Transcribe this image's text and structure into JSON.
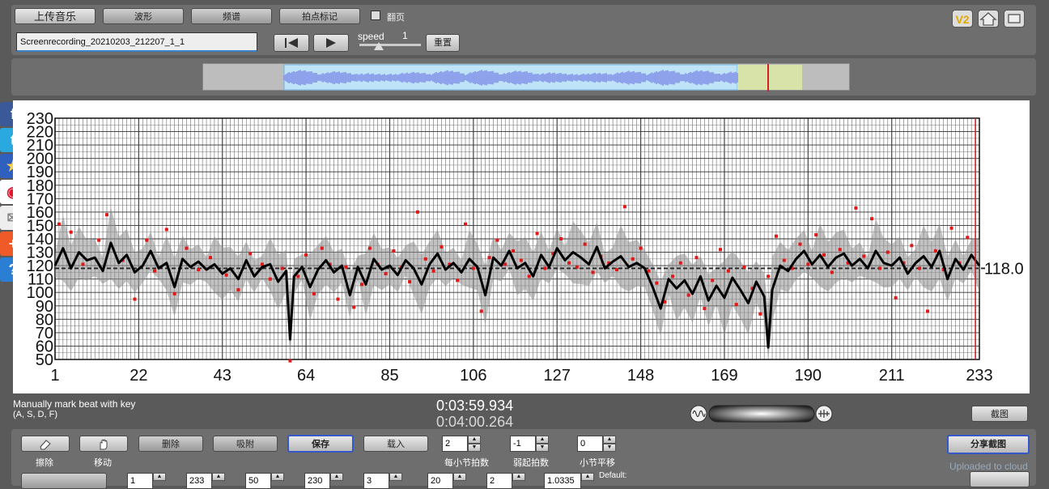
{
  "toolbar": {
    "upload_label": "上传音乐",
    "waveform_label": "波形",
    "spectrum_label": "频谱",
    "beat_mark_label": "拍点标记",
    "flip_label": "翻页",
    "filename": "Screenrecording_20210203_212207_1_1",
    "speed_label": "speed",
    "speed_value": "1",
    "reset_label": "重置",
    "v2_badge": "V2"
  },
  "chart_data": {
    "type": "line",
    "xlim": [
      1,
      233
    ],
    "ylim": [
      50,
      230
    ],
    "x_ticks": [
      1,
      22,
      43,
      64,
      85,
      106,
      127,
      148,
      169,
      190,
      211,
      233
    ],
    "y_ticks": [
      50,
      60,
      70,
      80,
      90,
      100,
      110,
      120,
      130,
      140,
      150,
      160,
      170,
      180,
      190,
      200,
      210,
      220,
      230
    ],
    "reference_value": 118.0,
    "reference_label": "118.0",
    "series": [
      {
        "x": [
          1,
          3,
          5,
          7,
          9,
          11,
          13,
          15,
          17,
          19,
          21,
          23,
          25,
          27,
          29,
          31,
          33,
          35,
          37,
          39,
          41,
          43,
          45,
          47,
          49,
          51,
          53,
          55,
          57,
          59,
          60,
          61,
          63,
          65,
          67,
          69,
          71,
          73,
          75,
          77,
          79,
          81,
          83,
          85,
          87,
          89,
          91,
          93,
          95,
          97,
          99,
          101,
          103,
          105,
          107,
          109,
          111,
          113,
          115,
          117,
          119,
          121,
          123,
          125,
          127,
          129,
          131,
          133,
          135,
          137,
          139,
          141,
          143,
          145,
          147,
          149,
          151,
          153,
          155,
          157,
          159,
          161,
          163,
          165,
          167,
          169,
          171,
          173,
          175,
          177,
          179,
          180,
          181,
          183,
          185,
          187,
          189,
          191,
          193,
          195,
          197,
          199,
          201,
          203,
          205,
          207,
          209,
          211,
          213,
          215,
          217,
          219,
          221,
          223,
          225,
          227,
          229,
          231,
          233
        ],
        "values": [
          120,
          133,
          118,
          130,
          124,
          126,
          116,
          137,
          122,
          128,
          115,
          120,
          131,
          118,
          122,
          104,
          125,
          119,
          123,
          117,
          121,
          114,
          118,
          110,
          124,
          112,
          119,
          121,
          108,
          116,
          65,
          112,
          119,
          104,
          117,
          124,
          115,
          120,
          98,
          119,
          106,
          125,
          117,
          120,
          113,
          124,
          118,
          106,
          121,
          129,
          117,
          122,
          115,
          125,
          119,
          98,
          126,
          120,
          131,
          118,
          122,
          112,
          128,
          119,
          133,
          124,
          130,
          126,
          121,
          134,
          118,
          123,
          127,
          119,
          122,
          118,
          104,
          88,
          110,
          103,
          109,
          99,
          112,
          94,
          105,
          96,
          111,
          102,
          92,
          108,
          97,
          59,
          102,
          120,
          116,
          125,
          131,
          121,
          128,
          119,
          126,
          129,
          120,
          125,
          118,
          131,
          122,
          120,
          126,
          114,
          122,
          127,
          119,
          131,
          110,
          125,
          117,
          128,
          120
        ]
      }
    ],
    "scatter_points": [
      [
        2,
        151
      ],
      [
        5,
        145
      ],
      [
        8,
        121
      ],
      [
        12,
        139
      ],
      [
        14,
        158
      ],
      [
        18,
        124
      ],
      [
        21,
        95
      ],
      [
        24,
        139
      ],
      [
        26,
        116
      ],
      [
        29,
        147
      ],
      [
        31,
        99
      ],
      [
        34,
        133
      ],
      [
        37,
        117
      ],
      [
        40,
        126
      ],
      [
        44,
        113
      ],
      [
        47,
        102
      ],
      [
        50,
        129
      ],
      [
        53,
        121
      ],
      [
        55,
        110
      ],
      [
        58,
        118
      ],
      [
        60,
        49
      ],
      [
        62,
        112
      ],
      [
        64,
        128
      ],
      [
        66,
        99
      ],
      [
        68,
        133
      ],
      [
        70,
        121
      ],
      [
        72,
        95
      ],
      [
        74,
        119
      ],
      [
        76,
        89
      ],
      [
        78,
        106
      ],
      [
        80,
        133
      ],
      [
        82,
        121
      ],
      [
        84,
        114
      ],
      [
        86,
        131
      ],
      [
        88,
        119
      ],
      [
        90,
        108
      ],
      [
        92,
        160
      ],
      [
        94,
        125
      ],
      [
        96,
        116
      ],
      [
        98,
        134
      ],
      [
        100,
        121
      ],
      [
        102,
        109
      ],
      [
        104,
        151
      ],
      [
        106,
        118
      ],
      [
        108,
        86
      ],
      [
        110,
        126
      ],
      [
        112,
        139
      ],
      [
        114,
        121
      ],
      [
        116,
        131
      ],
      [
        118,
        124
      ],
      [
        120,
        112
      ],
      [
        122,
        144
      ],
      [
        124,
        118
      ],
      [
        126,
        129
      ],
      [
        128,
        140
      ],
      [
        130,
        122
      ],
      [
        132,
        119
      ],
      [
        134,
        136
      ],
      [
        136,
        115
      ],
      [
        138,
        127
      ],
      [
        140,
        122
      ],
      [
        142,
        117
      ],
      [
        144,
        164
      ],
      [
        146,
        125
      ],
      [
        148,
        133
      ],
      [
        150,
        116
      ],
      [
        152,
        107
      ],
      [
        154,
        93
      ],
      [
        156,
        112
      ],
      [
        158,
        122
      ],
      [
        160,
        98
      ],
      [
        162,
        126
      ],
      [
        164,
        88
      ],
      [
        166,
        109
      ],
      [
        168,
        132
      ],
      [
        170,
        116
      ],
      [
        172,
        91
      ],
      [
        174,
        119
      ],
      [
        176,
        103
      ],
      [
        178,
        84
      ],
      [
        180,
        112
      ],
      [
        182,
        142
      ],
      [
        184,
        124
      ],
      [
        186,
        118
      ],
      [
        188,
        136
      ],
      [
        190,
        121
      ],
      [
        192,
        143
      ],
      [
        194,
        128
      ],
      [
        196,
        115
      ],
      [
        198,
        132
      ],
      [
        200,
        122
      ],
      [
        202,
        163
      ],
      [
        204,
        127
      ],
      [
        206,
        155
      ],
      [
        208,
        118
      ],
      [
        210,
        130
      ],
      [
        212,
        96
      ],
      [
        214,
        122
      ],
      [
        216,
        135
      ],
      [
        218,
        118
      ],
      [
        220,
        86
      ],
      [
        222,
        131
      ],
      [
        224,
        117
      ],
      [
        226,
        148
      ],
      [
        228,
        122
      ],
      [
        230,
        141
      ]
    ]
  },
  "readout": {
    "hint_line1": "Manually mark beat with key",
    "hint_line2": "(A, S, D, F)",
    "time_current": "0:03:59.934",
    "time_total": "0:04:00.264",
    "screenshot_label": "截图"
  },
  "controls": {
    "erase_label": "擦除",
    "move_label": "移动",
    "delete_label": "删除",
    "snap_label": "吸附",
    "save_label": "保存",
    "load_label": "载入",
    "beats_per_bar_value": "2",
    "beats_per_bar_label": "每小节拍数",
    "pickup_value": "-1",
    "pickup_label": "弱起拍数",
    "bar_shift_value": "0",
    "bar_shift_label": "小节平移",
    "share_label": "分享截图",
    "upload_cloud_label": "Uploaded to cloud",
    "row2_values": [
      "1",
      "233",
      "50",
      "230",
      "3",
      "20",
      "2",
      "1.0335"
    ],
    "default_label": "Default:"
  }
}
